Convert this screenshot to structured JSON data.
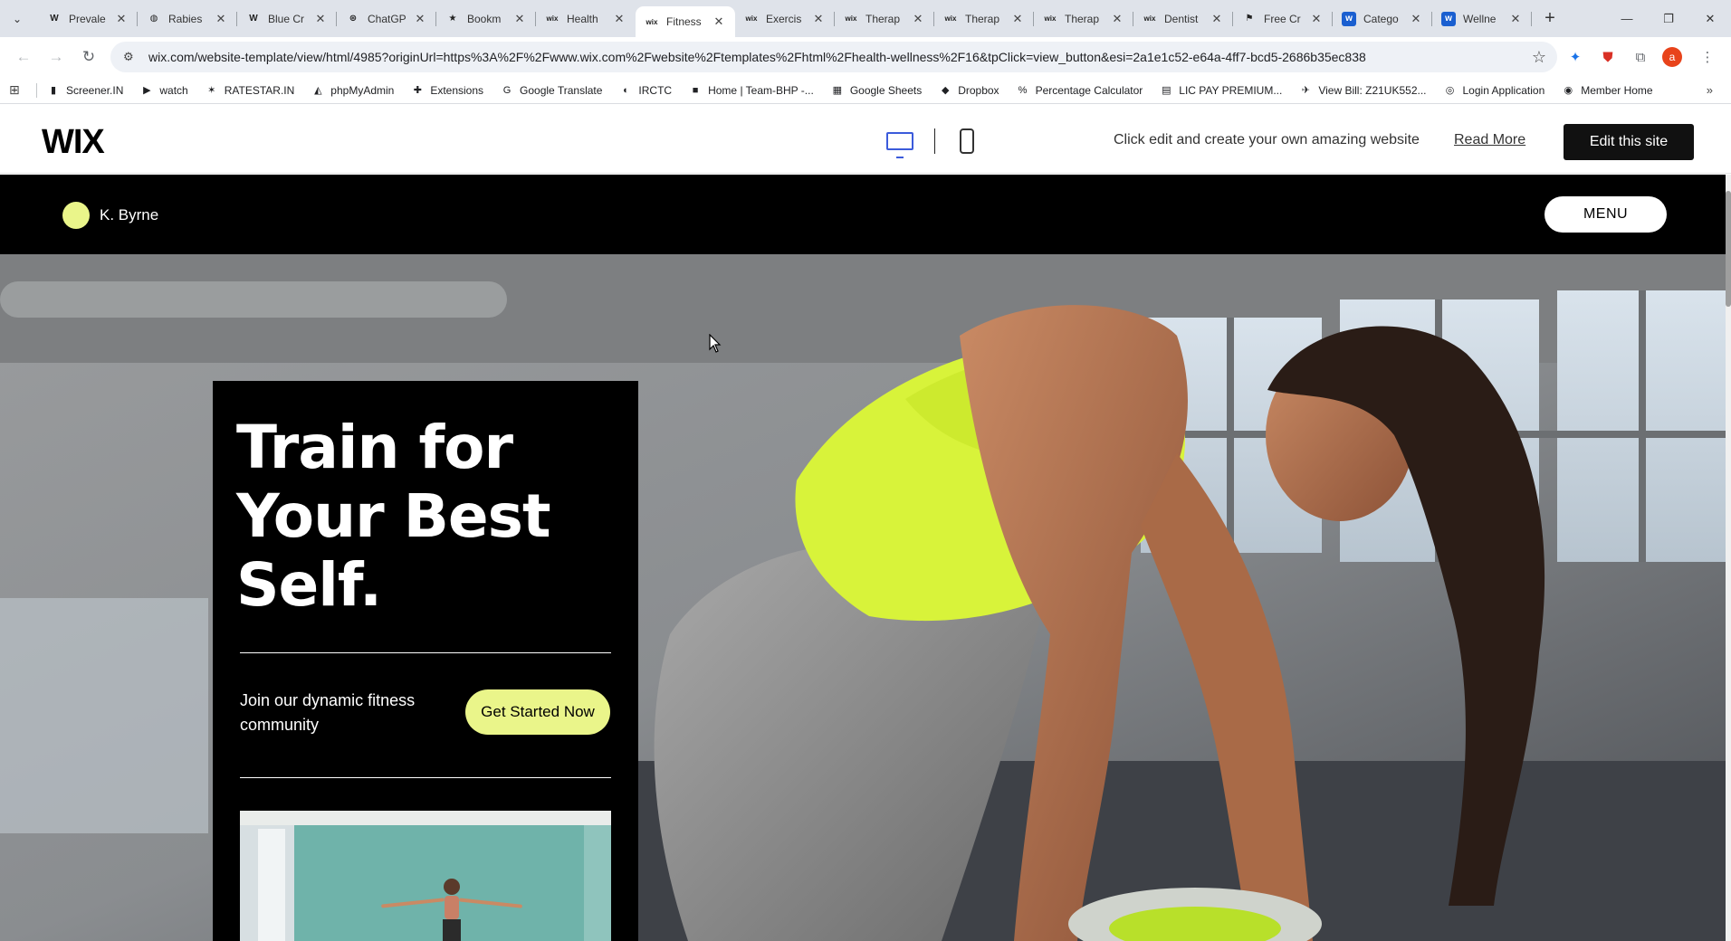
{
  "browser": {
    "tabs": [
      {
        "title": "Prevale",
        "icon": "W"
      },
      {
        "title": "Rabies",
        "icon": "◍"
      },
      {
        "title": "Blue Cr",
        "icon": "W"
      },
      {
        "title": "ChatGP",
        "icon": "⊛"
      },
      {
        "title": "Bookm",
        "icon": "★"
      },
      {
        "title": "Health",
        "icon": "wix"
      },
      {
        "title": "Fitness",
        "icon": "wix"
      },
      {
        "title": "Exercis",
        "icon": "wix"
      },
      {
        "title": "Therap",
        "icon": "wix"
      },
      {
        "title": "Therap",
        "icon": "wix"
      },
      {
        "title": "Therap",
        "icon": "wix"
      },
      {
        "title": "Dentist",
        "icon": "wix"
      },
      {
        "title": "Free Cr",
        "icon": "⚑"
      },
      {
        "title": "Catego",
        "icon": "w"
      },
      {
        "title": "Wellne",
        "icon": "w"
      }
    ],
    "active_tab_index": 6,
    "url": "wix.com/website-template/view/html/4985?originUrl=https%3A%2F%2Fwww.wix.com%2Fwebsite%2Ftemplates%2Fhtml%2Fhealth-wellness%2F16&tpClick=view_button&esi=2a1e1c52-e64a-4ff7-bcd5-2686b35ec838",
    "profile_initial": "a",
    "bookmarks": [
      {
        "label": "Screener.IN",
        "icon": "▮"
      },
      {
        "label": "watch",
        "icon": "▶"
      },
      {
        "label": "RATESTAR.IN",
        "icon": "✶"
      },
      {
        "label": "phpMyAdmin",
        "icon": "◭"
      },
      {
        "label": "Extensions",
        "icon": "✚"
      },
      {
        "label": "Google Translate",
        "icon": "G"
      },
      {
        "label": "IRCTC",
        "icon": "◐"
      },
      {
        "label": "Home | Team-BHP -...",
        "icon": "■"
      },
      {
        "label": "Google Sheets",
        "icon": "▦"
      },
      {
        "label": "Dropbox",
        "icon": "◆"
      },
      {
        "label": "Percentage Calculator",
        "icon": "%"
      },
      {
        "label": "LIC PAY PREMIUM...",
        "icon": "▤"
      },
      {
        "label": "View Bill: Z21UK552...",
        "icon": "✈"
      },
      {
        "label": "Login Application",
        "icon": "◎"
      },
      {
        "label": "Member Home",
        "icon": "◉"
      }
    ]
  },
  "wix_preview": {
    "logo": "WIX",
    "message": "Click edit and create your own amazing website",
    "read_more": "Read More",
    "edit_button": "Edit this site",
    "accent_color": "#3b5bdb"
  },
  "site": {
    "brand_name": "K. Byrne",
    "menu_label": "MENU",
    "headline": "Train for Your Best Self.",
    "tagline": "Join our dynamic fitness community",
    "cta_label": "Get Started Now",
    "accent_color": "#eaf58a"
  }
}
